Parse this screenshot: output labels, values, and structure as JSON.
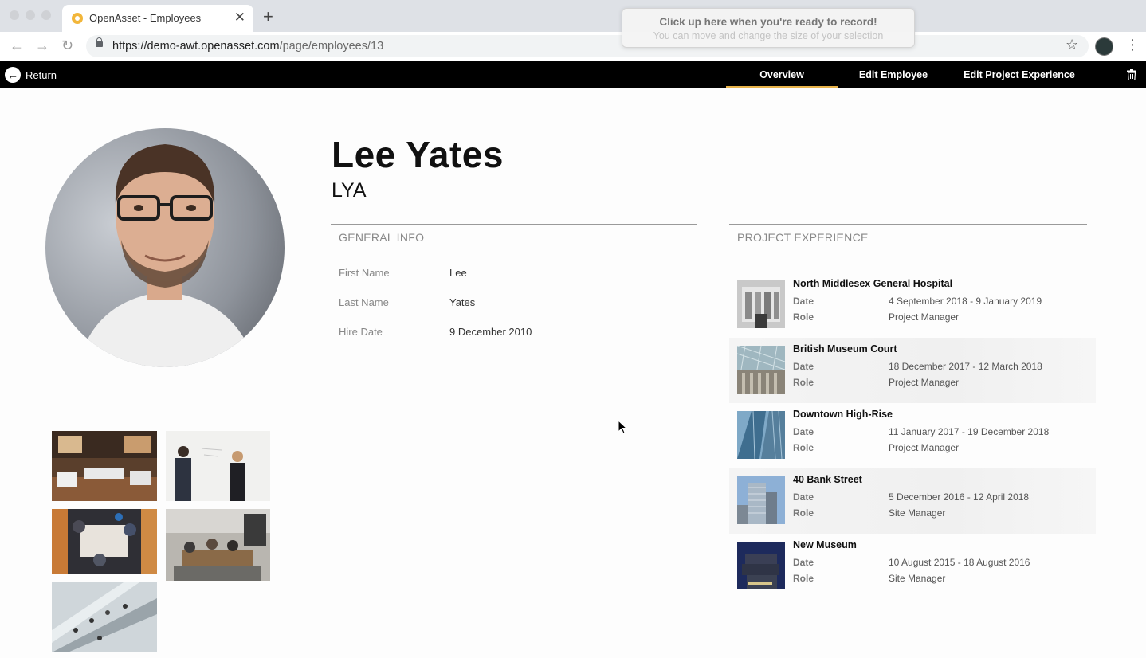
{
  "browser": {
    "tab_title": "OpenAsset - Employees",
    "url_host": "https://demo-awt.openasset.com",
    "url_path": "/page/employees/13"
  },
  "recorder": {
    "title": "Click up here when you're ready to record!",
    "subtitle": "You can move and change the size of your selection"
  },
  "header": {
    "return_label": "Return",
    "tabs": [
      {
        "label": "Overview",
        "active": true
      },
      {
        "label": "Edit Employee",
        "active": false
      },
      {
        "label": "Edit Project Experience",
        "active": false
      }
    ],
    "accent_color": "#e8b34a"
  },
  "employee": {
    "name": "Lee Yates",
    "initials": "LYA"
  },
  "general_info": {
    "title": "GENERAL INFO",
    "fields": [
      {
        "label": "First Name",
        "value": "Lee"
      },
      {
        "label": "Last Name",
        "value": "Yates"
      },
      {
        "label": "Hire Date",
        "value": "9 December 2010"
      }
    ]
  },
  "project_experience": {
    "title": "PROJECT EXPERIENCE",
    "date_label": "Date",
    "role_label": "Role",
    "projects": [
      {
        "name": "North Middlesex General Hospital",
        "date": "4 September 2018 - 9 January 2019",
        "role": "Project Manager"
      },
      {
        "name": "British Museum Court",
        "date": "18 December 2017 - 12 March 2018",
        "role": "Project Manager"
      },
      {
        "name": "Downtown High-Rise",
        "date": "11 January 2017 - 19 December 2018",
        "role": "Project Manager"
      },
      {
        "name": "40 Bank Street",
        "date": "5 December 2016 - 12 April 2018",
        "role": "Site Manager"
      },
      {
        "name": "New Museum",
        "date": "10 August 2015 - 18 August 2016",
        "role": "Site Manager"
      }
    ]
  }
}
